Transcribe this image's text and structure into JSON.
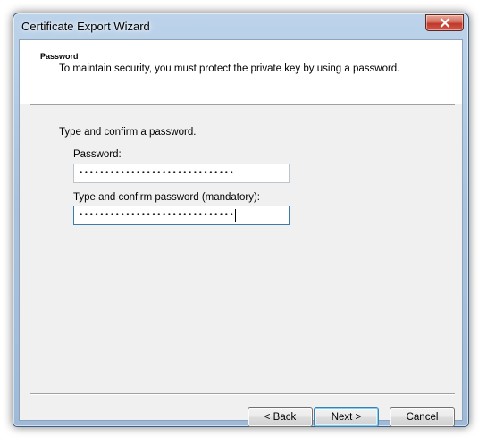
{
  "window": {
    "title": "Certificate Export Wizard",
    "close_icon": "close-x-icon"
  },
  "header": {
    "title": "Password",
    "description": "To maintain security, you must protect the private key by using a password."
  },
  "body": {
    "instruction": "Type and confirm a password.",
    "password": {
      "label": "Password:",
      "masked_value": "••••••••••••••••••••••••••••••"
    },
    "confirm": {
      "label": "Type and confirm password (mandatory):",
      "masked_value": "••••••••••••••••••••••••••••••"
    }
  },
  "buttons": {
    "back": "< Back",
    "next": "Next >",
    "cancel": "Cancel"
  }
}
